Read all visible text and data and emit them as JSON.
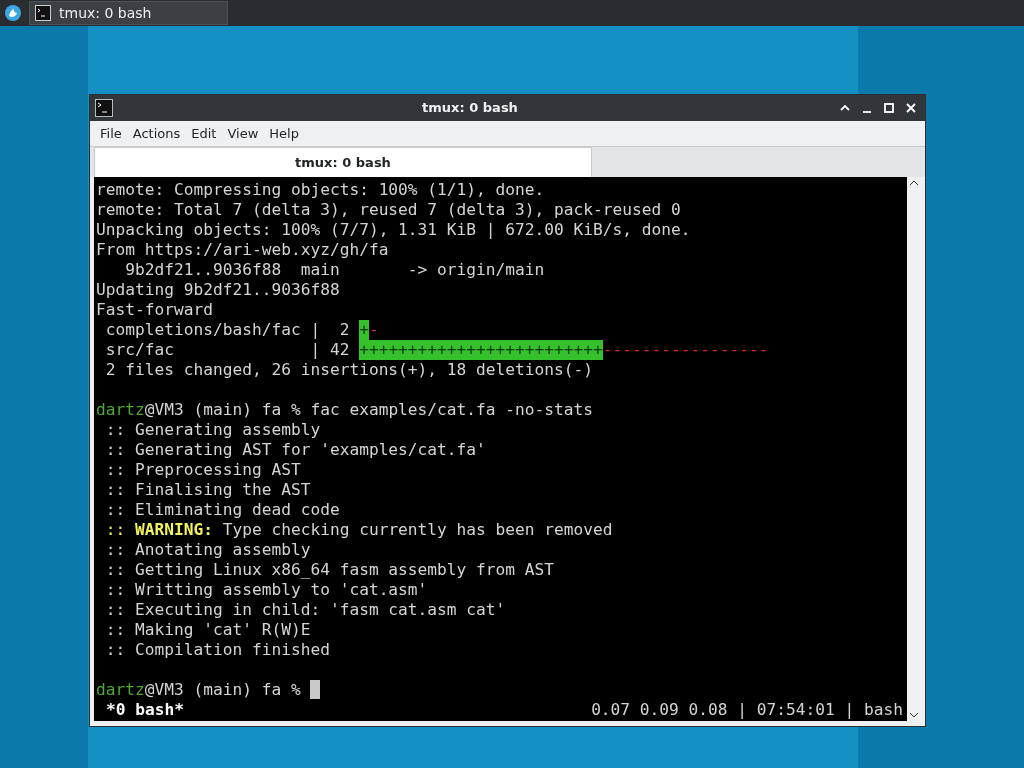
{
  "taskbar": {
    "tasks": [
      {
        "label": "tmux: 0 bash",
        "selected": true
      }
    ]
  },
  "window": {
    "title": "tmux: 0 bash",
    "menu": [
      "File",
      "Actions",
      "Edit",
      "View",
      "Help"
    ],
    "tabs": [
      {
        "label": "tmux: 0 bash",
        "selected": true
      }
    ],
    "terminal": {
      "lines": [
        {
          "segments": [
            {
              "kind": "plain",
              "text": "remote: Compressing objects: 100% (1/1), done."
            }
          ]
        },
        {
          "segments": [
            {
              "kind": "plain",
              "text": "remote: Total 7 (delta 3), reused 7 (delta 3), pack-reused 0"
            }
          ]
        },
        {
          "segments": [
            {
              "kind": "plain",
              "text": "Unpacking objects: 100% (7/7), 1.31 KiB | 672.00 KiB/s, done."
            }
          ]
        },
        {
          "segments": [
            {
              "kind": "plain",
              "text": "From https://ari-web.xyz/gh/fa"
            }
          ]
        },
        {
          "segments": [
            {
              "kind": "plain",
              "text": "   9b2df21..9036f88  main       -> origin/main"
            }
          ]
        },
        {
          "segments": [
            {
              "kind": "plain",
              "text": "Updating 9b2df21..9036f88"
            }
          ]
        },
        {
          "segments": [
            {
              "kind": "plain",
              "text": "Fast-forward"
            }
          ]
        },
        {
          "segments": [
            {
              "kind": "plain",
              "text": " completions/bash/fac |  2 "
            },
            {
              "kind": "added",
              "text": "+"
            },
            {
              "kind": "removed",
              "text": "-"
            }
          ]
        },
        {
          "segments": [
            {
              "kind": "plain",
              "text": " src/fac              | 42 "
            },
            {
              "kind": "added",
              "text": "+++++++++++++++++++++++++"
            },
            {
              "kind": "removed",
              "text": "-----------------"
            }
          ]
        },
        {
          "segments": [
            {
              "kind": "plain",
              "text": " 2 files changed, 26 insertions(+), 18 deletions(-)"
            }
          ]
        },
        {
          "kind": "blank"
        },
        {
          "segments": [
            {
              "kind": "user",
              "text": "dartz"
            },
            {
              "kind": "plain",
              "text": "@VM3 (main) fa % fac examples/cat.fa -no-stats"
            }
          ]
        },
        {
          "segments": [
            {
              "kind": "plain",
              "text": " :: Generating assembly"
            }
          ]
        },
        {
          "segments": [
            {
              "kind": "plain",
              "text": " :: Generating AST for 'examples/cat.fa'"
            }
          ]
        },
        {
          "segments": [
            {
              "kind": "plain",
              "text": " :: Preprocessing AST"
            }
          ]
        },
        {
          "segments": [
            {
              "kind": "plain",
              "text": " :: Finalising the AST"
            }
          ]
        },
        {
          "segments": [
            {
              "kind": "plain",
              "text": " :: Eliminating dead code"
            }
          ]
        },
        {
          "segments": [
            {
              "kind": "warn",
              "text": " :: "
            },
            {
              "kind": "warn-bold",
              "text": "WARNING:"
            },
            {
              "kind": "plain",
              "text": " Type checking currently has been removed"
            }
          ]
        },
        {
          "segments": [
            {
              "kind": "plain",
              "text": " :: Anotating assembly"
            }
          ]
        },
        {
          "segments": [
            {
              "kind": "plain",
              "text": " :: Getting Linux x86_64 fasm assembly from AST"
            }
          ]
        },
        {
          "segments": [
            {
              "kind": "plain",
              "text": " :: Writting assembly to 'cat.asm'"
            }
          ]
        },
        {
          "segments": [
            {
              "kind": "plain",
              "text": " :: Executing in child: 'fasm cat.asm cat'"
            }
          ]
        },
        {
          "segments": [
            {
              "kind": "plain",
              "text": " :: Making 'cat' R(W)E"
            }
          ]
        },
        {
          "segments": [
            {
              "kind": "plain",
              "text": " :: Compilation finished"
            }
          ]
        },
        {
          "kind": "blank"
        },
        {
          "segments": [
            {
              "kind": "user",
              "text": "dartz"
            },
            {
              "kind": "plain",
              "text": "@VM3 (main) fa % "
            }
          ],
          "cursor": true
        }
      ],
      "status_left": "*0 bash*",
      "status_right": "0.07 0.09 0.08 | 07:54:01 | bash"
    }
  }
}
